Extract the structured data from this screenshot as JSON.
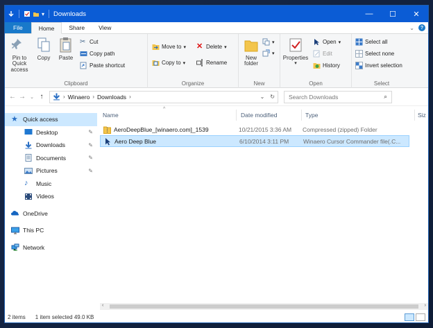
{
  "window": {
    "title": "Downloads",
    "controls": {
      "minimize": "—",
      "maximize": "☐",
      "close": "✕"
    }
  },
  "ribbon_tabs": [
    "File",
    "Home",
    "Share",
    "View"
  ],
  "help_glyph": "?",
  "ribbon": {
    "clipboard": {
      "label": "Clipboard",
      "pin_to_quick_access": "Pin to Quick access",
      "copy": "Copy",
      "paste": "Paste",
      "cut": "Cut",
      "copy_path": "Copy path",
      "paste_shortcut": "Paste shortcut"
    },
    "organize": {
      "label": "Organize",
      "move_to": "Move to",
      "copy_to": "Copy to",
      "delete": "Delete",
      "rename": "Rename"
    },
    "new": {
      "label": "New",
      "new_folder": "New folder"
    },
    "open": {
      "label": "Open",
      "properties": "Properties",
      "open": "Open",
      "edit": "Edit",
      "history": "History"
    },
    "select": {
      "label": "Select",
      "select_all": "Select all",
      "select_none": "Select none",
      "invert_selection": "Invert selection"
    }
  },
  "address": {
    "crumbs": [
      "Winaero",
      "Downloads"
    ],
    "search_placeholder": "Search Downloads"
  },
  "nav_pane": {
    "quick_access": "Quick access",
    "pinned": [
      {
        "label": "Desktop",
        "icon": "desktop-icon"
      },
      {
        "label": "Downloads",
        "icon": "downloads-icon"
      },
      {
        "label": "Documents",
        "icon": "documents-icon"
      },
      {
        "label": "Pictures",
        "icon": "pictures-icon"
      }
    ],
    "unpinned": [
      {
        "label": "Music",
        "icon": "music-icon"
      },
      {
        "label": "Videos",
        "icon": "videos-icon"
      }
    ],
    "onedrive": "OneDrive",
    "this_pc": "This PC",
    "network": "Network"
  },
  "file_list": {
    "columns": [
      "Name",
      "Date modified",
      "Type",
      "Siz"
    ],
    "rows": [
      {
        "name": "AeroDeepBlue_[winaero.com]_1539",
        "date": "10/21/2015 3:36 AM",
        "type": "Compressed (zipped) Folder",
        "icon": "zip-folder-icon",
        "selected": false
      },
      {
        "name": "Aero Deep Blue",
        "date": "6/10/2014 3:11 PM",
        "type": "Winaero Cursor Commander file(.C...",
        "icon": "cursor-icon",
        "selected": true
      }
    ]
  },
  "status": {
    "item_count": "2 items",
    "selection": "1 item selected  49.0 KB"
  },
  "colors": {
    "titlebar": "#0b5cd5",
    "file_tab": "#1979ca",
    "selection": "#cce8ff"
  }
}
